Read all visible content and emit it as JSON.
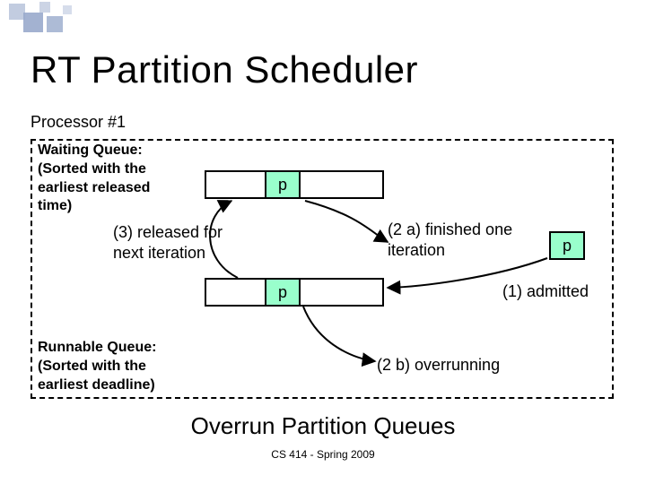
{
  "title": "RT Partition Scheduler",
  "processor_label": "Processor #1",
  "waiting_queue_label": "Waiting Queue:\n(Sorted with the\nearliest released\ntime)",
  "runnable_queue_label": "Runnable Queue:\n(Sorted with the\nearliest deadline)",
  "p_top": "p",
  "p_bottom": "p",
  "p_side": "p",
  "ann_released": "(3) released for\nnext iteration",
  "ann_finished": "(2 a) finished one\niteration",
  "ann_admitted": "(1) admitted",
  "ann_overrun": "(2 b) overrunning",
  "caption": "Overrun Partition Queues",
  "footer": "CS 414 - Spring 2009"
}
